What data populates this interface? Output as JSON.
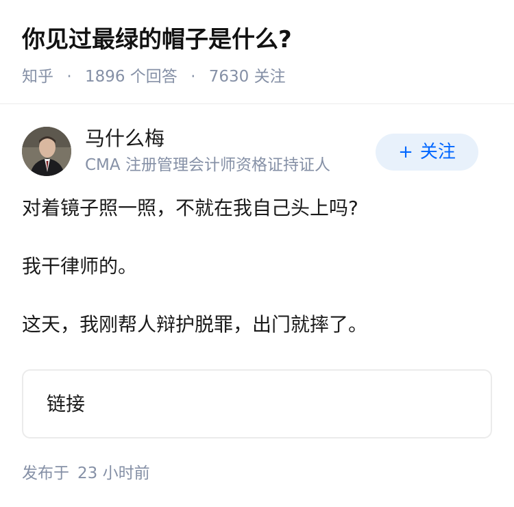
{
  "question": {
    "title": "你见过最绿的帽子是什么?",
    "source": "知乎",
    "answer_count": "1896",
    "answer_count_label": "个回答",
    "follower_count": "7630",
    "follower_count_label": "关注"
  },
  "author": {
    "name": "马什么梅",
    "bio": "CMA 注册管理会计师资格证持证人",
    "follow_label": "关注",
    "follow_icon": "plus-icon"
  },
  "answer": {
    "paragraphs": [
      "对着镜子照一照，不就在我自己头上吗?",
      "我干律师的。",
      "这天，我刚帮人辩护脱罪，出门就摔了。"
    ],
    "link_label": "链接"
  },
  "publish": {
    "prefix": "发布于",
    "value": "23 小时前"
  }
}
